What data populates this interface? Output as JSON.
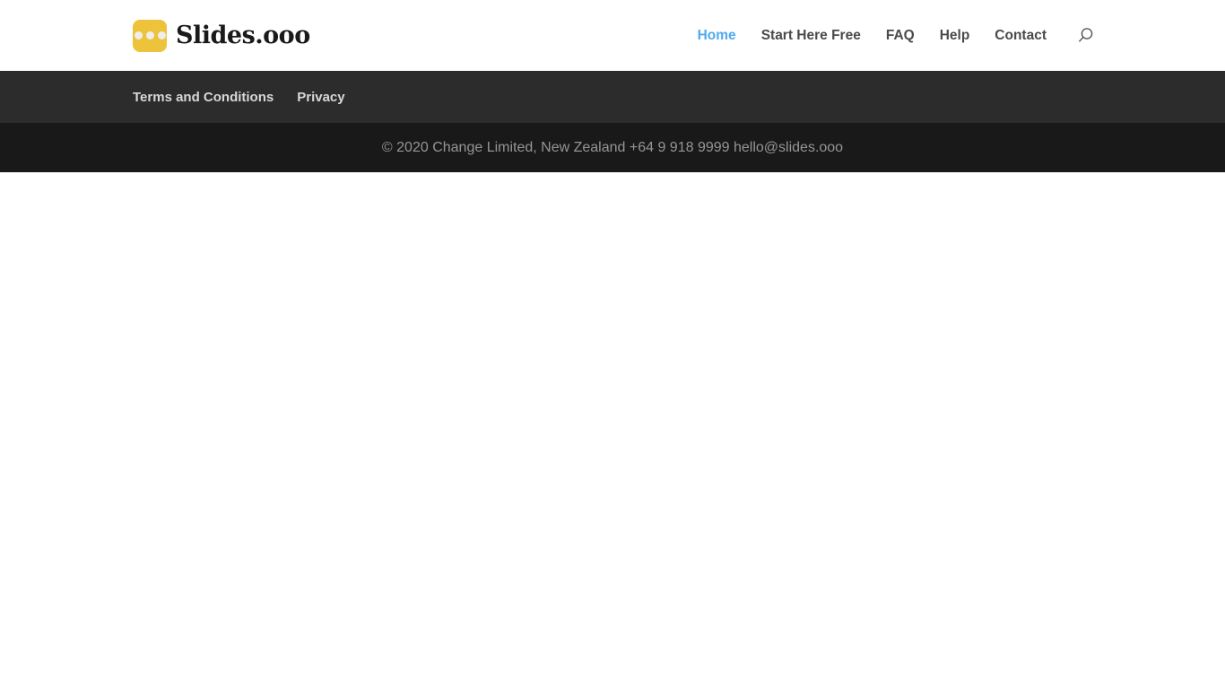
{
  "header": {
    "brand": {
      "logo_icon": "slides-logo-icon",
      "logo_color": "#eec33c",
      "dot_color": "#eeeeee",
      "name": "Slides.ooo"
    },
    "nav": {
      "items": [
        {
          "label": "Home",
          "active": true
        },
        {
          "label": "Start Here Free",
          "active": false
        },
        {
          "label": "FAQ",
          "active": false
        },
        {
          "label": "Help",
          "active": false
        },
        {
          "label": "Contact",
          "active": false
        }
      ],
      "active_color": "#4eaaf0",
      "inactive_color": "#4a4a4a",
      "search_icon": "search-icon"
    }
  },
  "footer": {
    "nav": {
      "items": [
        {
          "label": "Terms and Conditions"
        },
        {
          "label": "Privacy"
        }
      ],
      "band_color": "#2c2c2c",
      "link_color": "#d8d8d8"
    },
    "copyright": {
      "text": "© 2020 Change Limited, New Zealand +64 9 918 9999 hello@slides.ooo",
      "band_color": "#191919",
      "text_color": "#959595"
    }
  }
}
